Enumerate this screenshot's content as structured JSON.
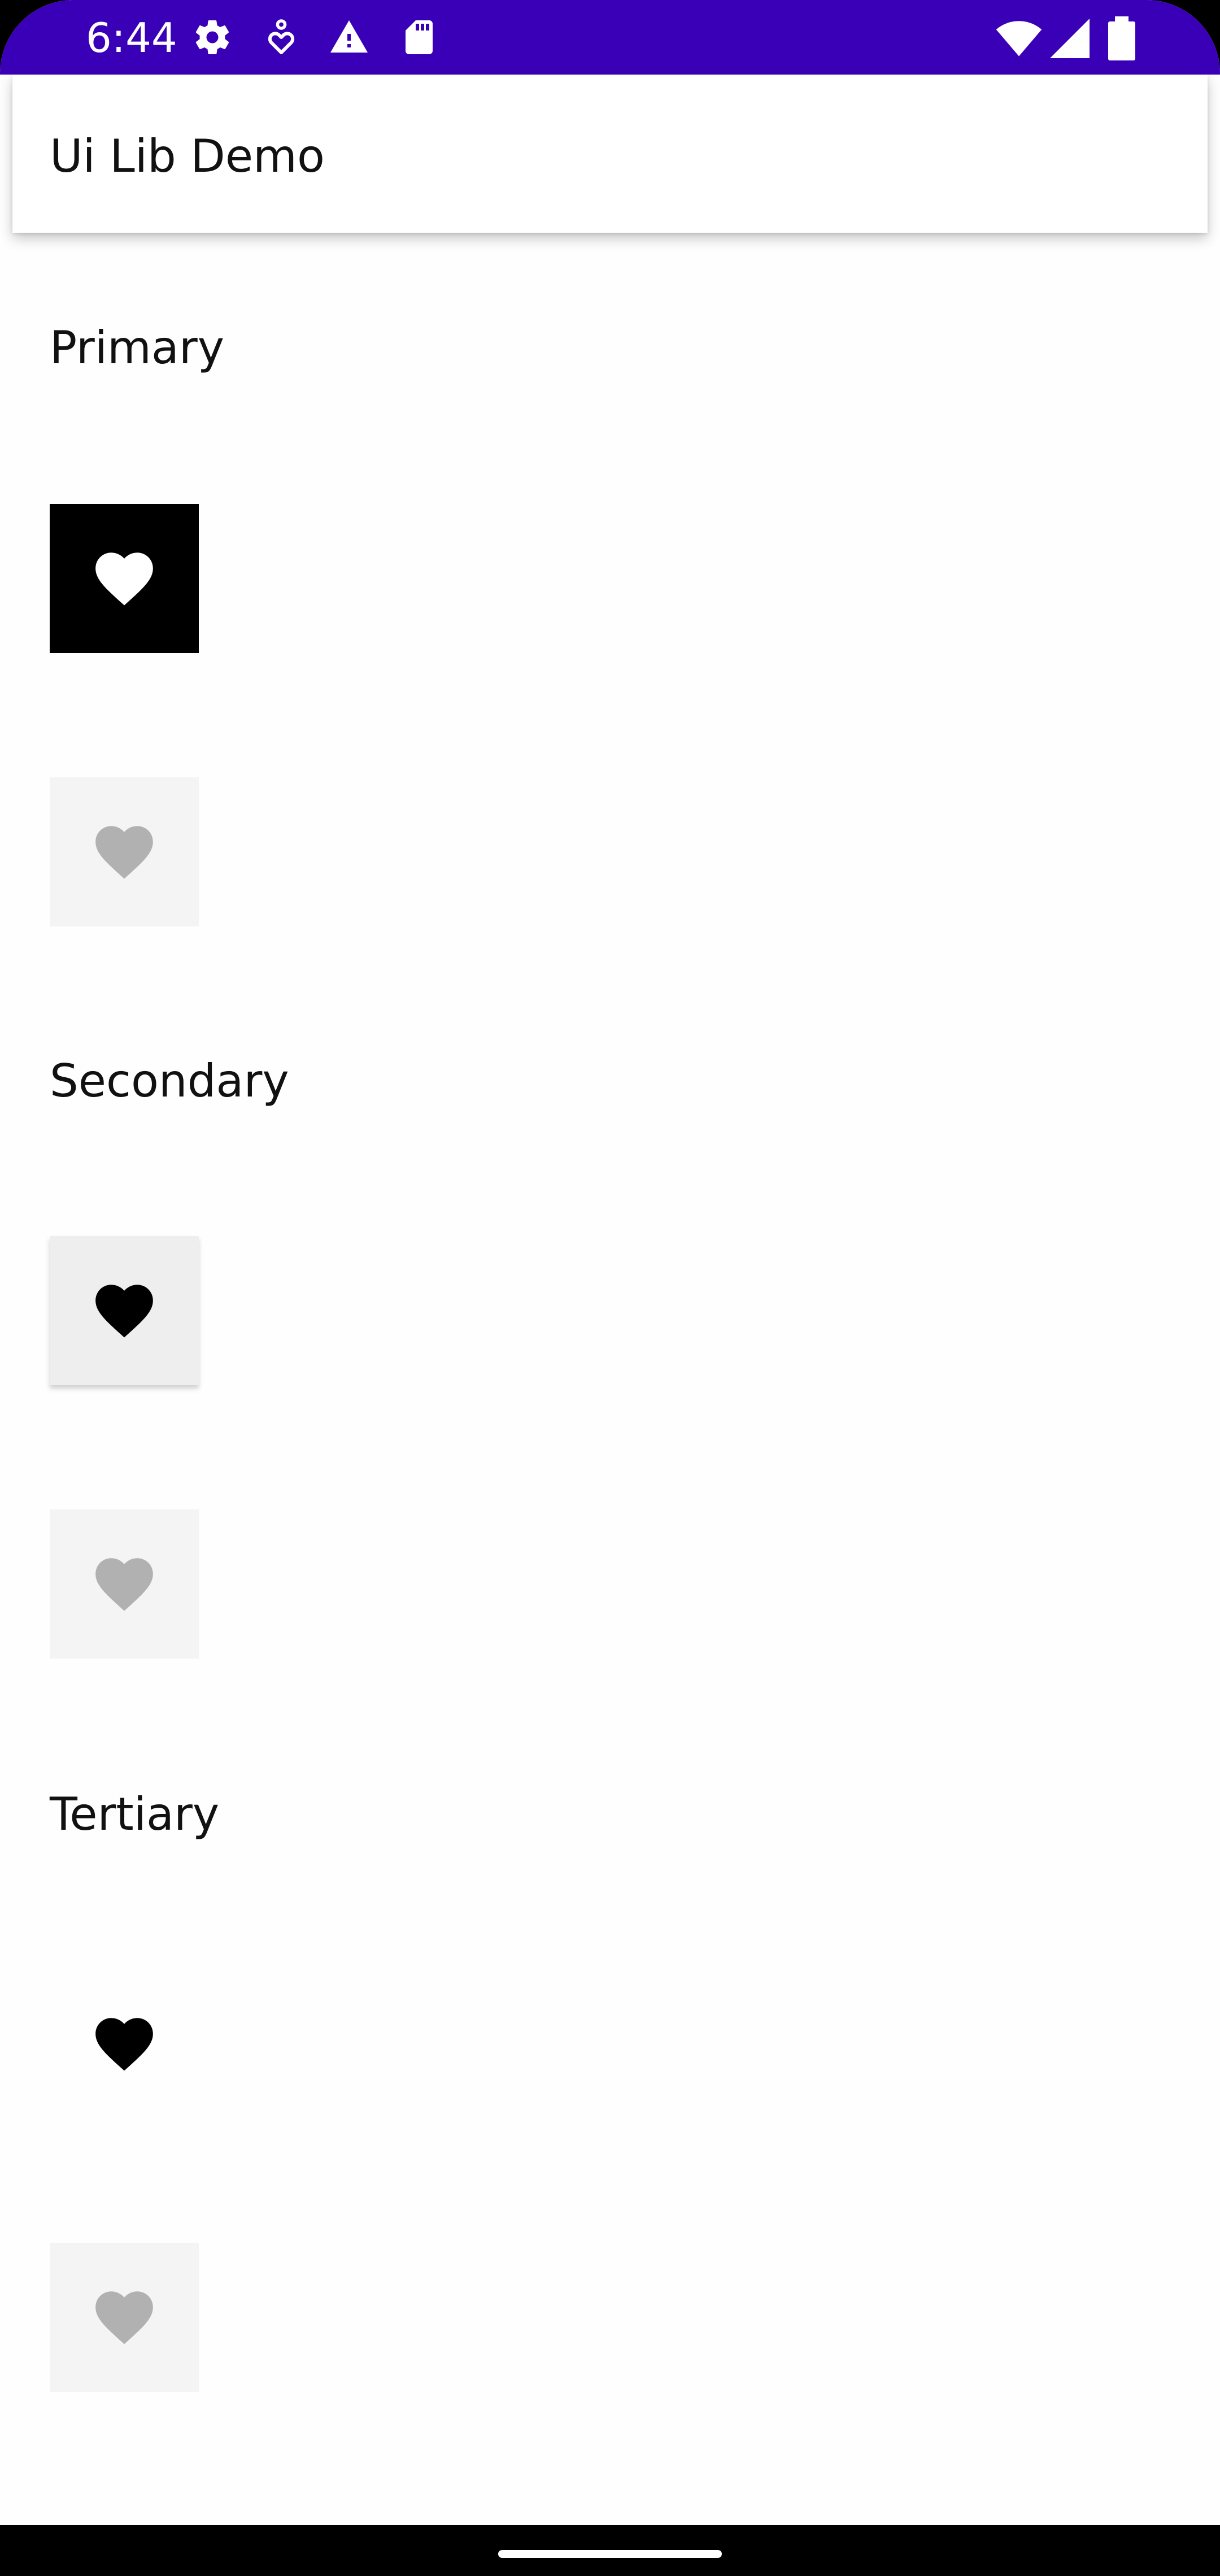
{
  "status_bar": {
    "time": "6:44",
    "background_color": "#3a00b7",
    "left_icons": [
      "settings-icon",
      "accessibility-icon",
      "warning-icon",
      "sd-card-icon"
    ],
    "right_icons": [
      "wifi-icon",
      "cellular-signal-icon",
      "battery-icon"
    ]
  },
  "app_bar": {
    "title": "Ui Lib Demo"
  },
  "sections": [
    {
      "label": "Primary",
      "buttons": [
        {
          "state": "enabled",
          "icon": "heart-icon",
          "background": "#000000",
          "icon_color": "#ffffff"
        },
        {
          "state": "disabled",
          "icon": "heart-icon",
          "background": "#f4f4f4",
          "icon_color": "#b1b1b1"
        }
      ]
    },
    {
      "label": "Secondary",
      "buttons": [
        {
          "state": "enabled",
          "icon": "heart-icon",
          "background": "#eeeeee",
          "icon_color": "#000000"
        },
        {
          "state": "disabled",
          "icon": "heart-icon",
          "background": "#f4f4f4",
          "icon_color": "#b1b1b1"
        }
      ]
    },
    {
      "label": "Tertiary",
      "buttons": [
        {
          "state": "enabled",
          "icon": "heart-icon",
          "background": "transparent",
          "icon_color": "#000000"
        },
        {
          "state": "disabled",
          "icon": "heart-icon",
          "background": "#f4f4f4",
          "icon_color": "#b1b1b1"
        }
      ]
    }
  ]
}
